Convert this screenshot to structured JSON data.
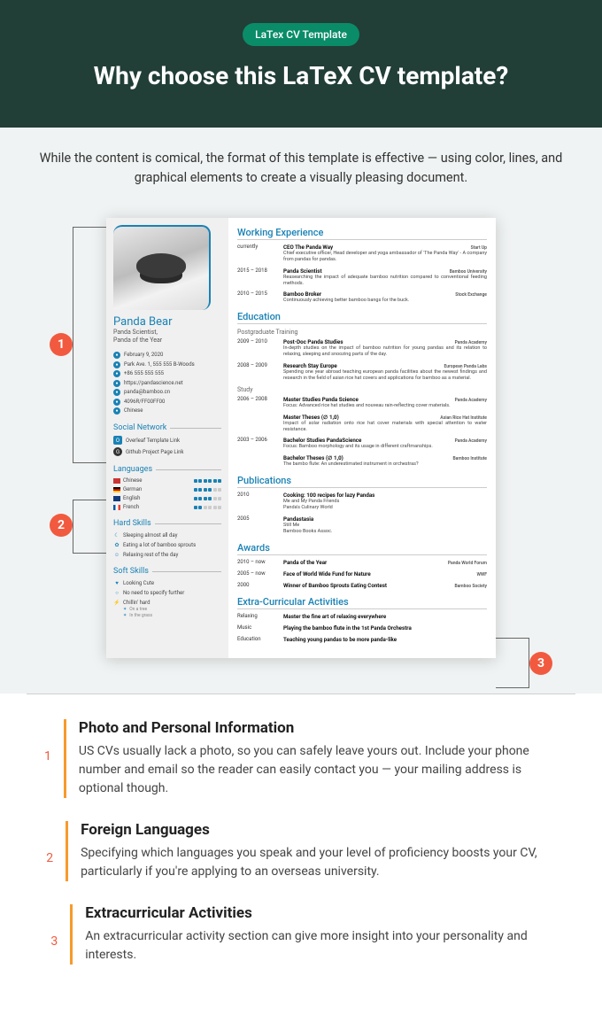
{
  "header": {
    "badge": "LaTex CV Template",
    "headline": "Why choose this LaTeX CV template?"
  },
  "intro": "While the content is comical, the format of this template is effective — using color, lines, and graphical elements to create a visually pleasing document.",
  "cv": {
    "name": "Panda Bear",
    "tagline": "Panda Scientist,\nPanda of the Year",
    "info": [
      {
        "icon": "●",
        "text": "February 9, 2020"
      },
      {
        "icon": "●",
        "text": "Park Ave. 1, 555 555 B-Woods"
      },
      {
        "icon": "●",
        "text": "+86 555 555 555"
      },
      {
        "icon": "●",
        "text": "https://pandascience.net"
      },
      {
        "icon": "●",
        "text": "panda@bamboo.cn"
      },
      {
        "icon": "●",
        "text": "4096R/FF00FF00"
      },
      {
        "icon": "●",
        "text": "Chinese"
      }
    ],
    "sideSections": {
      "social": {
        "title": "Social Network",
        "items": [
          {
            "icon": "O",
            "label": "Overleaf Template Link"
          },
          {
            "icon": "G",
            "label": "Github Project Page Link"
          }
        ]
      },
      "languages": {
        "title": "Languages",
        "items": [
          {
            "flag": "cn",
            "name": "Chinese",
            "level": 6
          },
          {
            "flag": "de",
            "name": "German",
            "level": 4
          },
          {
            "flag": "en",
            "name": "English",
            "level": 4
          },
          {
            "flag": "fr",
            "name": "French",
            "level": 2
          }
        ]
      },
      "hard": {
        "title": "Hard Skills",
        "items": [
          {
            "icon": "☾",
            "label": "Sleeping almost all day"
          },
          {
            "icon": "✿",
            "label": "Eating a lot of bamboo sprouts"
          },
          {
            "icon": "☺",
            "label": "Relaxing rest of the day"
          }
        ]
      },
      "soft": {
        "title": "Soft Skills",
        "items": [
          {
            "icon": "♥",
            "label": "Looking Cute"
          },
          {
            "icon": "○",
            "label": "No need to specify further"
          },
          {
            "icon": "⚡",
            "label": "Chillin' hard"
          }
        ],
        "subs": [
          {
            "icon": "✶",
            "label": "On a tree"
          },
          {
            "icon": "✶",
            "label": "In the grass"
          }
        ]
      }
    },
    "sections": {
      "work": {
        "title": "Working Experience",
        "entries": [
          {
            "date": "currently",
            "title": "CEO The Panda Way",
            "org": "Start Up",
            "desc": "Chief executive officer, Head developer and yoga ambassador of 'The Panda Way' - A company from pandas for pandas."
          },
          {
            "date": "2015 – 2018",
            "title": "Panda Scientist",
            "org": "Bamboo University",
            "desc": "Reasearching the impact of adequate bamboo nutrition compared to conventional feeding methods."
          },
          {
            "date": "2010 – 2015",
            "title": "Bamboo Broker",
            "org": "Stock Exchange",
            "desc": "Continuously achieving better bamboo bangs for the buck."
          }
        ]
      },
      "edu": {
        "title": "Education",
        "sub1": "Postgraduate Training",
        "entries1": [
          {
            "date": "2009 – 2010",
            "title": "Post-Doc Panda Studies",
            "org": "Panda Academy",
            "desc": "In-depth studies on the impact of bamboo nutrition for young pandas and its relation to relaxing, sleeping and snoozing parts of the day."
          },
          {
            "date": "2008 – 2009",
            "title": "Research Stay Europe",
            "org": "European Panda Labs",
            "desc": "Spending one year abroad teaching european panda facilities about the newest findings and research in the field of asian rice hat covers and applications for bamboo as a material."
          }
        ],
        "sub2": "Study",
        "entries2": [
          {
            "date": "2006 – 2008",
            "title": "Master Studies Panda Science",
            "org": "Panda Academy",
            "desc": "Focus: Advanced rice hat studies and nouveau rain-reflecting cover materials."
          },
          {
            "date": "",
            "title": "Master Theses (∅ 1,0)",
            "org": "Asian Rice Hat Institute",
            "desc": "Impact of solar radiation onto rice hat cover materials with special attention to water resistance."
          },
          {
            "date": "2003 – 2006",
            "title": "Bachelor Studies PandaScience",
            "org": "Panda Academy",
            "desc": "Focus: Bamboo morphology and its usage in different craftmanships."
          },
          {
            "date": "",
            "title": "Bachelor Theses (∅ 1,0)",
            "org": "Bamboo Institute",
            "desc": "The bambo flute: An underestimated instrument in orchestras?"
          }
        ]
      },
      "pub": {
        "title": "Publications",
        "entries": [
          {
            "date": "2010",
            "title": "Cooking: 100 recipes for lazy Pandas",
            "desc": "Me and My Panda Friends\nPanda's Culinary World"
          },
          {
            "date": "2005",
            "title": "Pandastasia",
            "desc": "Still Me\nBamboo Books Assoc."
          }
        ]
      },
      "awards": {
        "title": "Awards",
        "entries": [
          {
            "date": "2010 – now",
            "title": "Panda of the Year",
            "org": "Panda World Forum"
          },
          {
            "date": "2005 – now",
            "title": "Face of World Wide Fund for Nature",
            "org": "WWF"
          },
          {
            "date": "2000",
            "title": "Winner of Bamboo Sprouts Eating Contest",
            "org": "Bamboo Society"
          }
        ]
      },
      "extra": {
        "title": "Extra-Curricular Activities",
        "entries": [
          {
            "date": "Relaxing",
            "title": "Master the fine art of relaxing everywhere"
          },
          {
            "date": "Music",
            "title": "Playing the bamboo flute in the 1st Panda Orchestra"
          },
          {
            "date": "Education",
            "title": "Teaching young pandas to be more panda-like"
          }
        ]
      }
    }
  },
  "markers": {
    "1": "1",
    "2": "2",
    "3": "3"
  },
  "notes": [
    {
      "num": "1",
      "title": "Photo and Personal Information",
      "text": "US CVs usually lack a photo, so you can safely leave yours out. Include your phone number and email so the reader can easily contact you — your mailing address is optional though."
    },
    {
      "num": "2",
      "title": "Foreign Languages",
      "text": "Specifying which languages you speak and your level of proficiency boosts your CV, particularly if you're applying to an overseas university."
    },
    {
      "num": "3",
      "title": "Extracurricular Activities",
      "text": "An extracurricular activity section can give more insight into your personality and interests."
    }
  ]
}
